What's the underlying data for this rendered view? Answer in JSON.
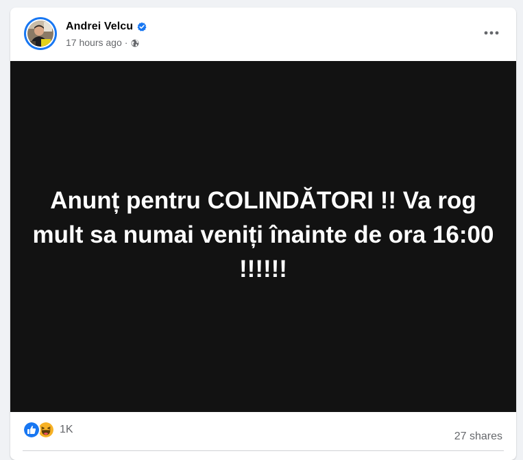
{
  "post": {
    "author": "Andrei Velcu",
    "timestamp": "17 hours ago",
    "separator": "·",
    "audience_icon": "globe-icon",
    "verified_icon": "verified-badge-icon",
    "more_icon": "more-options-icon",
    "text": "Anunț pentru COLINDĂTORI !! Va rog mult sa numai veniți înainte de ora 16:00 !!!!!!"
  },
  "stats": {
    "reaction_icons": [
      "like-icon",
      "haha-icon"
    ],
    "reactions_count": "1K",
    "shares": "27 shares"
  },
  "colors": {
    "page_background": "#f0f2f5",
    "card_background": "#ffffff",
    "post_background": "#121212",
    "accent": "#1877f2",
    "secondary_text": "#65676b",
    "haha_yellow": "#f7b125"
  }
}
